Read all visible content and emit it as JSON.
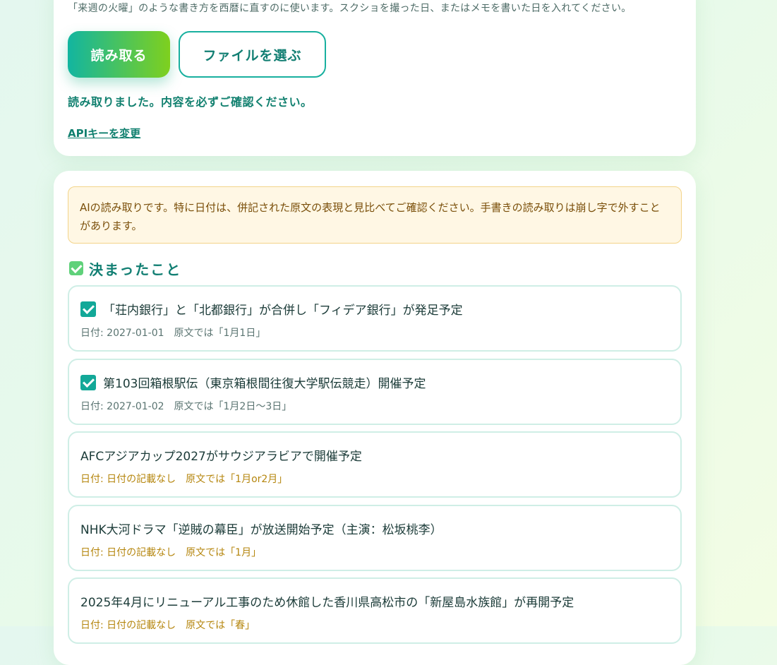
{
  "input_card": {
    "hint": "「来週の火曜」のような書き方を西暦に直すのに使います。スクショを撮った日、またはメモを書いた日を入れてください。",
    "read_button": "読み取る",
    "file_button": "ファイルを選ぶ",
    "status": "読み取りました。内容を必ずご確認ください。",
    "api_key_link": "APIキーを変更"
  },
  "result_card": {
    "warning": "AIの読み取りです。特に日付は、併記された原文の表現と見比べてご確認ください。手書きの読み取りは崩し字で外すことがあります。",
    "section_title": "決まったこと",
    "items": [
      {
        "checked": true,
        "text": "「荘内銀行」と「北都銀行」が合併し「フィデア銀行」が発足予定",
        "date": "日付: 2027-01-01　原文では「1月1日」"
      },
      {
        "checked": true,
        "text": "第103回箱根駅伝（東京箱根間往復大学駅伝競走）開催予定",
        "date": "日付: 2027-01-02　原文では「1月2日～3日」"
      },
      {
        "checked": false,
        "text": "AFCアジアカップ2027がサウジアラビアで開催予定",
        "date": "日付: 日付の記載なし　原文では「1月or2月」"
      },
      {
        "checked": false,
        "text": "NHK大河ドラマ「逆賊の幕臣」が放送開始予定（主演：松坂桃李）",
        "date": "日付: 日付の記載なし　原文では「1月」"
      },
      {
        "checked": false,
        "text": "2025年4月にリニューアル工事のため休館した香川県高松市の「新屋島水族館」が再開予定",
        "date": "日付: 日付の記載なし　原文では「春」"
      }
    ]
  },
  "colors": {
    "accent": "#12b5a0",
    "accent_end": "#7fd01e",
    "link": "#11806f",
    "warning_bg": "#fff7e4",
    "no_date": "#b5860e"
  }
}
